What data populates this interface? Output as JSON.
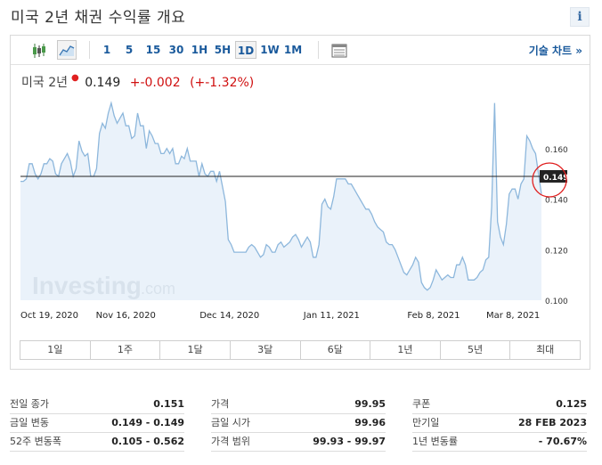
{
  "page": {
    "title": "미국 2년 채권 수익률 개요",
    "info_label": "i"
  },
  "toolbar": {
    "timeframes": [
      "1",
      "5",
      "15",
      "30",
      "1H",
      "5H",
      "1D",
      "1W",
      "1M"
    ],
    "selected_timeframe": "1D",
    "tech_chart_link": "기술 차트 »"
  },
  "quote": {
    "name": "미국 2년",
    "price": "0.149",
    "change": "+-0.002",
    "change_pct": "(+-1.32%)"
  },
  "watermark": {
    "brand": "Investing",
    "suffix": ".com"
  },
  "chart_data": {
    "type": "area",
    "x_tick_labels": [
      "Oct 19, 2020",
      "Nov 16, 2020",
      "Dec 14, 2020",
      "Jan 11, 2021",
      "Feb 8, 2021",
      "Mar 8, 2021"
    ],
    "y_tick_labels": [
      "0.160",
      "0.140",
      "0.120",
      "0.100"
    ],
    "ylim": [
      0.1,
      0.18
    ],
    "last_value_label": "0.149",
    "reference_line": 0.149,
    "values": [
      0.147,
      0.147,
      0.148,
      0.154,
      0.154,
      0.15,
      0.148,
      0.15,
      0.154,
      0.154,
      0.156,
      0.155,
      0.15,
      0.149,
      0.154,
      0.156,
      0.158,
      0.155,
      0.149,
      0.152,
      0.163,
      0.159,
      0.157,
      0.158,
      0.149,
      0.149,
      0.152,
      0.166,
      0.17,
      0.168,
      0.174,
      0.178,
      0.173,
      0.17,
      0.172,
      0.174,
      0.169,
      0.169,
      0.164,
      0.165,
      0.174,
      0.169,
      0.169,
      0.16,
      0.167,
      0.165,
      0.162,
      0.162,
      0.158,
      0.158,
      0.16,
      0.158,
      0.16,
      0.154,
      0.154,
      0.157,
      0.156,
      0.16,
      0.155,
      0.155,
      0.155,
      0.149,
      0.154,
      0.15,
      0.149,
      0.151,
      0.151,
      0.147,
      0.151,
      0.145,
      0.139,
      0.124,
      0.122,
      0.119,
      0.119,
      0.119,
      0.119,
      0.119,
      0.121,
      0.122,
      0.121,
      0.119,
      0.117,
      0.118,
      0.122,
      0.121,
      0.119,
      0.119,
      0.122,
      0.123,
      0.121,
      0.122,
      0.123,
      0.125,
      0.126,
      0.124,
      0.121,
      0.123,
      0.125,
      0.123,
      0.117,
      0.117,
      0.122,
      0.138,
      0.14,
      0.137,
      0.136,
      0.141,
      0.148,
      0.148,
      0.148,
      0.148,
      0.146,
      0.146,
      0.144,
      0.142,
      0.14,
      0.138,
      0.136,
      0.136,
      0.134,
      0.131,
      0.129,
      0.128,
      0.127,
      0.123,
      0.122,
      0.122,
      0.12,
      0.117,
      0.114,
      0.111,
      0.11,
      0.112,
      0.114,
      0.117,
      0.115,
      0.107,
      0.105,
      0.104,
      0.105,
      0.108,
      0.112,
      0.11,
      0.108,
      0.109,
      0.11,
      0.109,
      0.109,
      0.114,
      0.114,
      0.117,
      0.114,
      0.108,
      0.108,
      0.108,
      0.109,
      0.111,
      0.112,
      0.116,
      0.117,
      0.137,
      0.178,
      0.131,
      0.125,
      0.122,
      0.13,
      0.142,
      0.144,
      0.144,
      0.14,
      0.146,
      0.148,
      0.165,
      0.163,
      0.16,
      0.158,
      0.15,
      0.142
    ]
  },
  "time_ranges": [
    "1일",
    "1주",
    "1달",
    "3달",
    "6달",
    "1년",
    "5년",
    "최대"
  ],
  "stats": {
    "col1": [
      {
        "label": "전일 종가",
        "value": "0.151"
      },
      {
        "label": "금일 변동",
        "value": "0.149 - 0.149"
      },
      {
        "label": "52주 변동폭",
        "value": "0.105 - 0.562"
      }
    ],
    "col2": [
      {
        "label": "가격",
        "value": "99.95"
      },
      {
        "label": "금일 시가",
        "value": "99.96"
      },
      {
        "label": "가격 범위",
        "value": "99.93 - 99.97"
      }
    ],
    "col3": [
      {
        "label": "쿠폰",
        "value": "0.125"
      },
      {
        "label": "만기일",
        "value": "28 FEB 2023"
      },
      {
        "label": "1년 변동률",
        "value": "- 70.67%"
      }
    ]
  },
  "colors": {
    "accent": "#1a5a9c",
    "negative": "#d01010",
    "line": "#8db7dc",
    "fill": "#e3eef8"
  }
}
